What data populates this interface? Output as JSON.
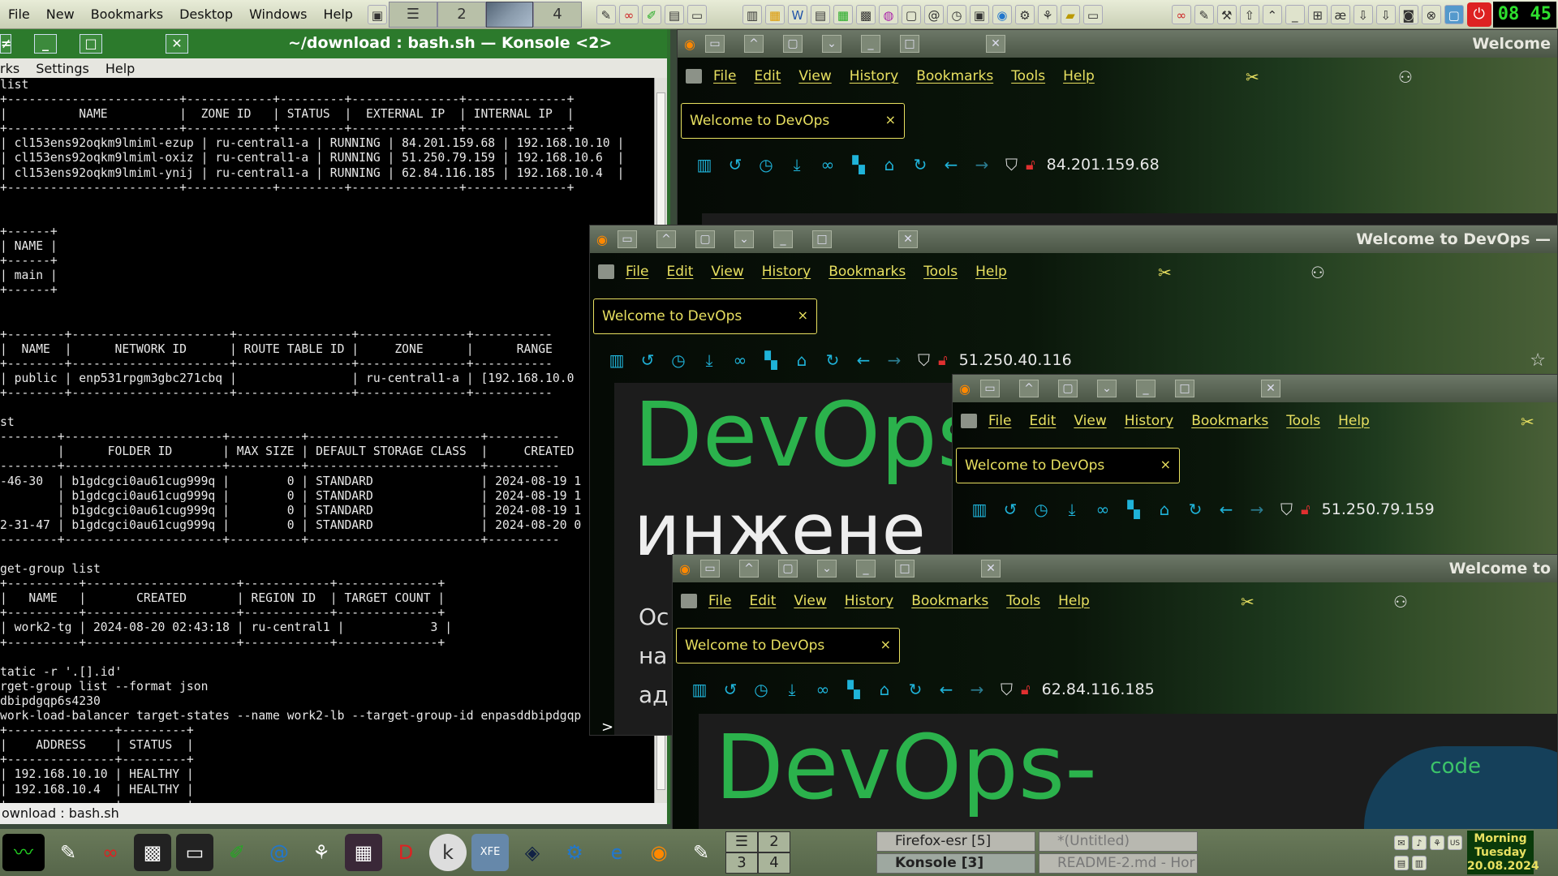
{
  "top_panel": {
    "menu": [
      "File",
      "New",
      "Bookmarks",
      "Desktop",
      "Windows",
      "Help"
    ],
    "pager_desk_2": "2",
    "pager_desk_4": "4",
    "clock": "08 45"
  },
  "konsole": {
    "title": "~/download : bash.sh — Konsole <2>",
    "menu": [
      "rks",
      "Settings",
      "Help"
    ],
    "status": "ownload : bash.sh",
    "lines": [
      "list",
      "+------------------------+------------+---------+---------------+--------------+",
      "|          NAME          |  ZONE ID   | STATUS  |  EXTERNAL IP  | INTERNAL IP  |",
      "+------------------------+------------+---------+---------------+--------------+",
      "| cl153ens92oqkm9lmiml-ezup | ru-central1-a | RUNNING | 84.201.159.68 | 192.168.10.10 |",
      "| cl153ens92oqkm9lmiml-oxiz | ru-central1-a | RUNNING | 51.250.79.159 | 192.168.10.6  |",
      "| cl153ens92oqkm9lmiml-ynij | ru-central1-a | RUNNING | 62.84.116.185 | 192.168.10.4  |",
      "+------------------------+------------+---------+---------------+--------------+",
      "",
      "",
      "+------+",
      "| NAME |",
      "+------+",
      "| main |",
      "+------+",
      "",
      "",
      "+--------+----------------------+----------------+---------------+-----------",
      "|  NAME  |      NETWORK ID      | ROUTE TABLE ID |     ZONE      |      RANGE",
      "+--------+----------------------+----------------+---------------+-----------",
      "| public | enp531rpgm3gbc271cbq |                | ru-central1-a | [192.168.10.0",
      "+--------+----------------------+----------------+---------------+-----------",
      "",
      "st",
      "--------+----------------------+----------+------------------------+----------",
      "        |      FOLDER ID       | MAX SIZE | DEFAULT STORAGE CLASS  |     CREATED",
      "--------+----------------------+----------+------------------------+----------",
      "-46-30  | b1gdcgci0au61cug999q |        0 | STANDARD               | 2024-08-19 1",
      "        | b1gdcgci0au61cug999q |        0 | STANDARD               | 2024-08-19 1",
      "        | b1gdcgci0au61cug999q |        0 | STANDARD               | 2024-08-19 1",
      "2-31-47 | b1gdcgci0au61cug999q |        0 | STANDARD               | 2024-08-20 0",
      "--------+----------------------+----------+------------------------+----------",
      "",
      "get-group list",
      "+----------+---------------------+------------+--------------+",
      "|   NAME   |       CREATED       | REGION ID  | TARGET COUNT |",
      "+----------+---------------------+------------+--------------+",
      "| work2-tg | 2024-08-20 02:43:18 | ru-central1 |            3 |",
      "+----------+---------------------+------------+--------------+",
      "",
      "tatic -r '.[].id'",
      "rget-group list --format json",
      "dbipdgqp6s4230",
      "work-load-balancer target-states --name work2-lb --target-group-id enpasddbipdgqp",
      "+---------------+---------+",
      "|    ADDRESS    | STATUS  |",
      "+---------------+---------+",
      "| 192.168.10.10 | HEALTHY |",
      "| 192.168.10.4  | HEALTHY |",
      "+---------------+---------+"
    ]
  },
  "firefox": {
    "menu": [
      "File",
      "Edit",
      "View",
      "History",
      "Bookmarks",
      "Tools",
      "Help"
    ],
    "tab_title": "Welcome to DevOps",
    "tab_close": "×",
    "windows": [
      {
        "title": "Welcome",
        "address": "84.201.159.68"
      },
      {
        "title": "Welcome to DevOps —",
        "address": "51.250.40.116"
      },
      {
        "title": "",
        "address": "51.250.79.159"
      },
      {
        "title": "Welcome to",
        "address": "62.84.116.185"
      }
    ],
    "page": {
      "devops_word": "DevOps",
      "devops_dash": "DevOps-",
      "russian_partial": "инжене",
      "line_a": "Ос",
      "line_b": "на",
      "line_c": "ад",
      "code_label": "code",
      "prompt": ">"
    }
  },
  "bottom_panel": {
    "pager": [
      "1",
      "2",
      "3",
      "4"
    ],
    "tasks": [
      {
        "label": "Firefox-esr [5]"
      },
      {
        "label": "Konsole [3]"
      },
      {
        "label": "*(Untitled)"
      },
      {
        "label": "README-2.md - Hor"
      }
    ],
    "clock_line1": "Morning",
    "clock_line2": "Tuesday",
    "clock_line3": "20.08.2024"
  }
}
